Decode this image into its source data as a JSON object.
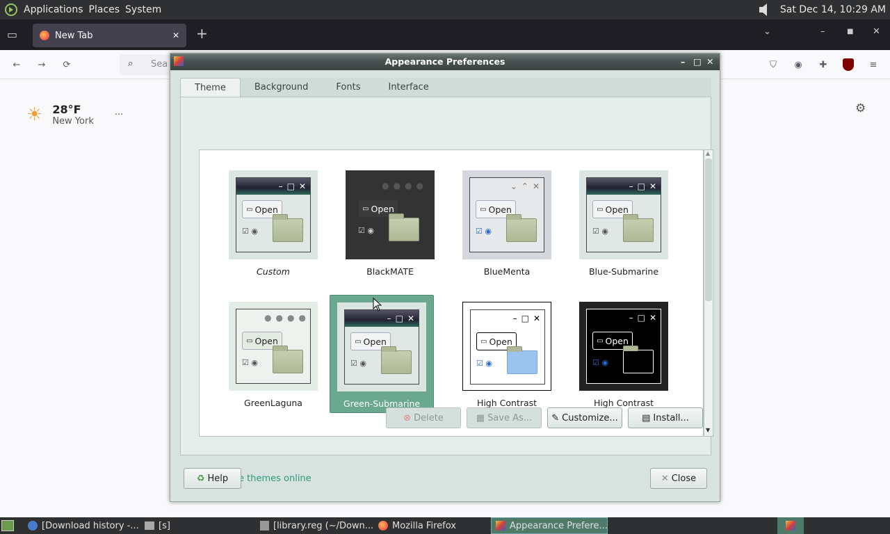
{
  "top_panel": {
    "menus": [
      "Applications",
      "Places",
      "System"
    ],
    "clock": "Sat Dec 14, 10:29 AM"
  },
  "firefox": {
    "tab_title": "New Tab",
    "search_placeholder": "Sea",
    "weather": {
      "temp": "28°F",
      "city": "New York"
    }
  },
  "dialog": {
    "title": "Appearance Preferences",
    "tabs": [
      "Theme",
      "Background",
      "Fonts",
      "Interface"
    ],
    "active_tab": "Theme",
    "themes": [
      {
        "name": "Custom",
        "style": "custom"
      },
      {
        "name": "BlackMATE",
        "style": "black"
      },
      {
        "name": "BlueMenta",
        "style": "menta"
      },
      {
        "name": "Blue-Submarine",
        "style": "submarine"
      },
      {
        "name": "GreenLaguna",
        "style": "laguna"
      },
      {
        "name": "Green-Submarine",
        "style": "submarine",
        "selected": true
      },
      {
        "name": "High Contrast",
        "style": "hc"
      },
      {
        "name": "High Contrast",
        "style": "hci"
      }
    ],
    "thumb_open_label": "Open",
    "buttons": {
      "delete": "Delete",
      "save_as": "Save As...",
      "customize": "Customize...",
      "install": "Install..."
    },
    "link": "Get more themes online",
    "help": "Help",
    "close": "Close"
  },
  "taskbar": {
    "tasks": [
      "[Download history -...",
      "[s]",
      "[library.reg (~/Down...",
      "Mozilla Firefox",
      "Appearance Prefere..."
    ]
  }
}
